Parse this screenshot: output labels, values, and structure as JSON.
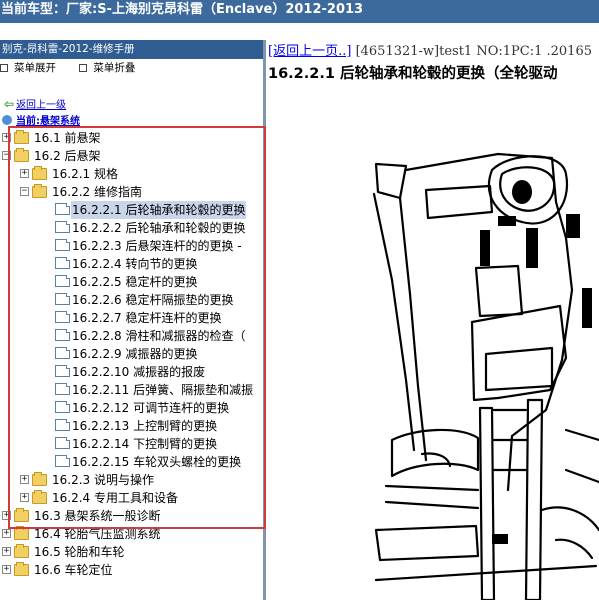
{
  "window": {
    "title": "当前车型：厂家:S-上海别克昂科雷（Enclave）2012-2013"
  },
  "sidebar": {
    "title": "别克-昂科雷-2012-维修手册",
    "expand_all": "菜单展开",
    "collapse_all": "菜单折叠",
    "back_link": "返回上一级",
    "current_section": "当前:悬架系统"
  },
  "tree": {
    "n1": {
      "num": "16.1",
      "label": "前悬架"
    },
    "n2": {
      "num": "16.2",
      "label": "后悬架"
    },
    "n3": {
      "num": "16.2.1",
      "label": "规格"
    },
    "n4": {
      "num": "16.2.2",
      "label": "维修指南"
    },
    "d1": {
      "num": "16.2.2.1",
      "label": "后轮轴承和轮毂的更换"
    },
    "d2": {
      "num": "16.2.2.2",
      "label": "后轮轴承和轮毂的更换"
    },
    "d3": {
      "num": "16.2.2.3",
      "label": "后悬架连杆的的更换 -"
    },
    "d4": {
      "num": "16.2.2.4",
      "label": "转向节的更换"
    },
    "d5": {
      "num": "16.2.2.5",
      "label": "稳定杆的更换"
    },
    "d6": {
      "num": "16.2.2.6",
      "label": "稳定杆隔振垫的更换"
    },
    "d7": {
      "num": "16.2.2.7",
      "label": "稳定杆连杆的更换"
    },
    "d8": {
      "num": "16.2.2.8",
      "label": "滑柱和减振器的检查（"
    },
    "d9": {
      "num": "16.2.2.9",
      "label": "减振器的更换"
    },
    "d10": {
      "num": "16.2.2.10",
      "label": "减振器的报废"
    },
    "d11": {
      "num": "16.2.2.11",
      "label": "后弹簧、隔振垫和减振"
    },
    "d12": {
      "num": "16.2.2.12",
      "label": "可调节连杆的更换"
    },
    "d13": {
      "num": "16.2.2.13",
      "label": "上控制臂的更换"
    },
    "d14": {
      "num": "16.2.2.14",
      "label": "下控制臂的更换"
    },
    "d15": {
      "num": "16.2.2.15",
      "label": "车轮双头螺栓的更换"
    },
    "n5": {
      "num": "16.2.3",
      "label": "说明与操作"
    },
    "n6": {
      "num": "16.2.4",
      "label": "专用工具和设备"
    },
    "n7": {
      "num": "16.3",
      "label": "悬架系统一般诊断"
    },
    "n8": {
      "num": "16.4",
      "label": "轮胎气压监测系统"
    },
    "n9": {
      "num": "16.5",
      "label": "轮胎和车轮"
    },
    "n10": {
      "num": "16.6",
      "label": "车轮定位"
    }
  },
  "content": {
    "back_link": "[返回上一页..]",
    "doc_ref": "[4651321-w]test1 NO:1PC:1 .20165",
    "heading": "16.2.2.1 后轮轴承和轮毂的更换（全轮驱动"
  },
  "colors": {
    "title_bar": "#3c6a9d",
    "highlight_border": "#d23b3b",
    "selection": "#c9d6ea"
  }
}
